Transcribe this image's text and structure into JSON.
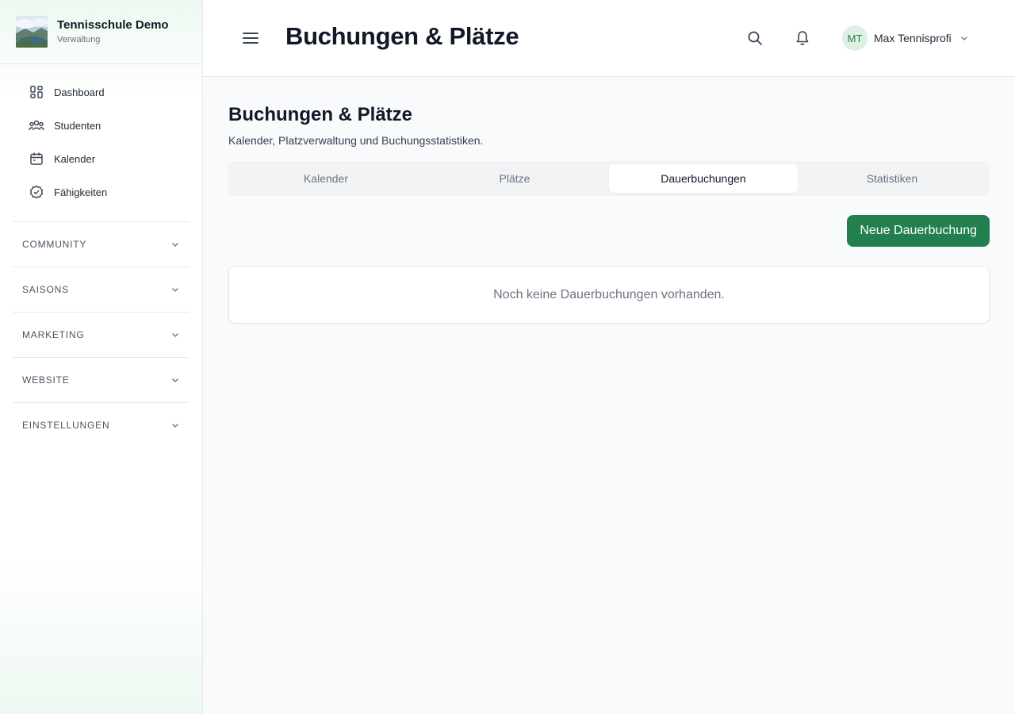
{
  "brand": {
    "name": "Tennisschule Demo",
    "subtitle": "Verwaltung"
  },
  "sidebar": {
    "items": [
      {
        "label": "Dashboard",
        "icon": "dashboard-icon"
      },
      {
        "label": "Studenten",
        "icon": "users-icon"
      },
      {
        "label": "Kalender",
        "icon": "calendar-icon"
      },
      {
        "label": "Fähigkeiten",
        "icon": "check-badge-icon"
      }
    ],
    "sections": [
      {
        "label": "COMMUNITY"
      },
      {
        "label": "SAISONS"
      },
      {
        "label": "MARKETING"
      },
      {
        "label": "WEBSITE"
      },
      {
        "label": "EINSTELLUNGEN"
      }
    ]
  },
  "header": {
    "title": "Buchungen & Plätze",
    "user": {
      "initials": "MT",
      "name": "Max Tennisprofi"
    }
  },
  "main": {
    "title": "Buchungen & Plätze",
    "subtitle": "Kalender, Platzverwaltung und Buchungsstatistiken.",
    "tabs": [
      {
        "label": "Kalender",
        "active": false
      },
      {
        "label": "Plätze",
        "active": false
      },
      {
        "label": "Dauerbuchungen",
        "active": true
      },
      {
        "label": "Statistiken",
        "active": false
      }
    ],
    "primary_action": "Neue Dauerbuchung",
    "empty_message": "Noch keine Dauerbuchungen vorhanden."
  },
  "colors": {
    "accent": "#22804f",
    "avatar_bg": "#dcf0e3",
    "sidebar_tint": "#eef8f1"
  }
}
